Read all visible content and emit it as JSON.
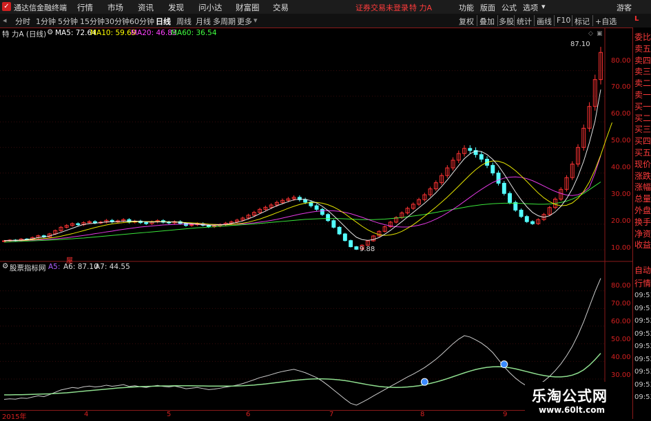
{
  "app": {
    "title": "通达信金融终端",
    "login_status": "证券交易未登录",
    "stock_name": "特 力A"
  },
  "menu": [
    "行情",
    "市场",
    "资讯",
    "发现",
    "问小达",
    "财富圈",
    "交易"
  ],
  "right_menu": [
    "功能",
    "版面",
    "公式",
    "选项",
    "游客"
  ],
  "tabs": [
    "分时",
    "1分钟",
    "5分钟",
    "15分钟",
    "30分钟",
    "60分钟",
    "日线",
    "周线",
    "月线",
    "多周期",
    "更多"
  ],
  "active_tab": "日线",
  "right_tabs": [
    "复权",
    "叠加",
    "多股",
    "统计",
    "画线",
    "F10",
    "标记",
    "+自选"
  ],
  "info": {
    "title": "特 力A (日线)",
    "ma5": "MA5: 72.64",
    "ma10": "MA10: 59.69",
    "ma20": "MA20: 46.83",
    "ma60": "MA60: 36.54",
    "colors": {
      "ma5": "#ffffff",
      "ma10": "#ffff00",
      "ma20": "#ff40ff",
      "ma60": "#40ff40"
    }
  },
  "main_axis": [
    "80.00",
    "70.00",
    "60.00",
    "50.00",
    "40.00",
    "30.00",
    "20.00",
    "10.00"
  ],
  "annotations": {
    "high": "87.10",
    "low": "9.88"
  },
  "lower": {
    "title": "股票指标网",
    "a5": "A5:",
    "a6": "A6: 87.10",
    "a7": "A7: 44.55",
    "mark": "屋"
  },
  "lower_axis": [
    "80.00",
    "70.00",
    "60.00",
    "50.00",
    "40.00",
    "30.00"
  ],
  "dates": [
    "2015年",
    "4",
    "5",
    "6",
    "7",
    "8",
    "9"
  ],
  "right_panel_top": [
    "委比",
    "卖五",
    "卖四",
    "卖三",
    "卖二",
    "卖一",
    "买一",
    "买二",
    "买三",
    "买四",
    "买五",
    "现价",
    "涨跌",
    "涨幅",
    "总量",
    "外盘",
    "换手",
    "净资",
    "收益"
  ],
  "right_panel_bottom": [
    "自动",
    "行情",
    "09:51",
    "09:51",
    "09:52",
    "09:52",
    "09:52",
    "09:52",
    "09:53",
    "09:53",
    "09:53"
  ],
  "top_right_label": "L",
  "watermark": {
    "line1": "乐淘公式网",
    "line2": "www.60lt.com"
  },
  "chart_data": {
    "type": "candlestick",
    "price_range": [
      5,
      92
    ],
    "closes": [
      13.5,
      13.8,
      13.6,
      14.2,
      14.0,
      14.8,
      15.5,
      15.0,
      16.2,
      17.5,
      18.8,
      19.5,
      20.2,
      19.8,
      20.6,
      21.0,
      20.5,
      20.8,
      21.5,
      20.9,
      21.3,
      21.8,
      20.8,
      21.2,
      20.6,
      20.2,
      20.9,
      21.4,
      20.8,
      20.5,
      21.0,
      20.3,
      19.5,
      19.8,
      20.2,
      19.6,
      19.0,
      19.3,
      19.8,
      20.4,
      20.9,
      21.6,
      22.4,
      23.5,
      24.6,
      25.8,
      26.6,
      27.5,
      28.5,
      29.3,
      29.9,
      30.5,
      29.6,
      28.6,
      27.2,
      25.8,
      23.8,
      21.4,
      18.8,
      16.2,
      13.6,
      11.2,
      10.2,
      11.8,
      13.5,
      15.4,
      17.2,
      19.0,
      20.8,
      22.6,
      24.4,
      26.2,
      27.8,
      29.6,
      31.5,
      33.8,
      36.2,
      39.0,
      42.0,
      45.0,
      47.6,
      49.6,
      48.8,
      47.2,
      45.4,
      43.0,
      40.0,
      36.0,
      32.0,
      28.5,
      25.5,
      23.0,
      21.0,
      20.2,
      21.8,
      23.8,
      26.5,
      29.8,
      33.6,
      38.2,
      43.5,
      50.0,
      57.5,
      66.0,
      76.5,
      87.1
    ],
    "ma5": [
      13.6,
      13.7,
      13.7,
      13.8,
      14.0,
      14.3,
      14.8,
      15.0,
      15.4,
      16.1,
      16.8,
      17.6,
      18.4,
      19.2,
      19.9,
      20.2,
      20.4,
      20.6,
      20.9,
      20.9,
      21.0,
      21.2,
      21.2,
      21.2,
      21.1,
      20.9,
      20.8,
      20.9,
      20.9,
      20.8,
      20.9,
      20.7,
      20.4,
      20.2,
      20.0,
      19.7,
      19.6,
      19.6,
      19.7,
      19.9,
      20.3,
      20.7,
      21.3,
      22.1,
      23.0,
      24.1,
      25.1,
      26.2,
      27.2,
      28.0,
      28.8,
      29.5,
      29.8,
      29.7,
      29.2,
      28.3,
      27.0,
      25.3,
      23.3,
      21.2,
      19.0,
      16.8,
      14.9,
      14.0,
      13.7,
      14.0,
      14.8,
      16.1,
      17.6,
      19.3,
      21.0,
      22.8,
      24.6,
      26.4,
      28.2,
      30.2,
      32.3,
      34.7,
      37.3,
      40.1,
      42.9,
      45.6,
      47.5,
      48.6,
      48.4,
      47.2,
      45.3,
      42.8,
      39.6,
      36.1,
      32.6,
      29.5,
      26.8,
      24.6,
      23.3,
      22.7,
      23.3,
      24.8,
      27.0,
      30.0,
      33.8,
      38.7,
      44.6,
      51.8,
      60.3,
      72.6
    ],
    "ma10": [
      13.6,
      13.6,
      13.7,
      13.7,
      13.8,
      14.0,
      14.2,
      14.4,
      14.6,
      14.9,
      15.3,
      15.8,
      16.3,
      16.9,
      17.5,
      18.1,
      18.7,
      19.2,
      19.7,
      20.1,
      20.4,
      20.6,
      20.8,
      20.9,
      21.0,
      21.0,
      21.0,
      21.0,
      21.0,
      20.9,
      20.9,
      20.8,
      20.6,
      20.5,
      20.4,
      20.2,
      20.0,
      19.9,
      19.8,
      19.8,
      19.9,
      20.1,
      20.4,
      20.8,
      21.4,
      22.0,
      22.8,
      23.6,
      24.5,
      25.3,
      26.2,
      27.0,
      27.7,
      28.2,
      28.5,
      28.5,
      28.2,
      27.6,
      26.7,
      25.5,
      24.0,
      22.4,
      20.8,
      19.2,
      17.8,
      16.7,
      15.9,
      15.6,
      15.8,
      16.3,
      17.2,
      18.4,
      19.8,
      21.4,
      23.1,
      24.9,
      26.7,
      28.6,
      30.6,
      32.7,
      34.9,
      37.1,
      39.3,
      41.3,
      43.0,
      44.2,
      44.7,
      44.6,
      43.9,
      42.6,
      40.9,
      38.9,
      36.7,
      34.4,
      32.2,
      30.3,
      28.8,
      27.7,
      27.2,
      27.4,
      28.3,
      30.1,
      32.8,
      36.5,
      41.3,
      47.0,
      53.5,
      59.7
    ],
    "ma20": [
      13.5,
      13.5,
      13.6,
      13.6,
      13.7,
      13.8,
      13.9,
      14.0,
      14.1,
      14.3,
      14.5,
      14.7,
      15.0,
      15.3,
      15.6,
      15.9,
      16.3,
      16.6,
      17.0,
      17.3,
      17.7,
      18.0,
      18.3,
      18.6,
      18.9,
      19.1,
      19.3,
      19.5,
      19.7,
      19.8,
      19.9,
      20.0,
      20.0,
      20.0,
      20.0,
      20.0,
      19.9,
      19.9,
      19.9,
      19.9,
      19.9,
      20.0,
      20.1,
      20.3,
      20.5,
      20.8,
      21.1,
      21.5,
      21.9,
      22.4,
      22.9,
      23.4,
      23.9,
      24.3,
      24.7,
      25.0,
      25.2,
      25.3,
      25.2,
      25.0,
      24.6,
      24.1,
      23.4,
      22.7,
      21.9,
      21.1,
      20.4,
      19.8,
      19.3,
      19.0,
      18.9,
      18.9,
      19.2,
      19.6,
      20.2,
      21.0,
      22.0,
      23.1,
      24.4,
      25.8,
      27.3,
      28.9,
      30.5,
      32.1,
      33.6,
      35.0,
      36.3,
      37.3,
      38.0,
      38.4,
      38.5,
      38.3,
      37.8,
      37.0,
      36.0,
      34.9,
      33.8,
      32.8,
      32.0,
      31.4,
      31.2,
      31.5,
      32.5,
      34.4,
      40.0,
      46.8
    ],
    "ma60": [
      13.0,
      13.1,
      13.2,
      13.3,
      13.4,
      13.5,
      13.6,
      13.7,
      13.8,
      13.9,
      14.0,
      14.2,
      14.3,
      14.5,
      14.6,
      14.8,
      15.0,
      15.2,
      15.4,
      15.6,
      15.8,
      16.0,
      16.2,
      16.4,
      16.6,
      16.8,
      17.0,
      17.2,
      17.4,
      17.6,
      17.8,
      18.0,
      18.2,
      18.4,
      18.6,
      18.7,
      18.9,
      19.0,
      19.2,
      19.3,
      19.5,
      19.6,
      19.8,
      19.9,
      20.1,
      20.3,
      20.5,
      20.7,
      20.9,
      21.1,
      21.3,
      21.5,
      21.7,
      21.9,
      22.0,
      22.1,
      22.2,
      22.2,
      22.2,
      22.2,
      22.1,
      22.0,
      21.9,
      21.8,
      21.8,
      21.8,
      21.9,
      22.0,
      22.2,
      22.4,
      22.6,
      22.9,
      23.2,
      23.5,
      23.8,
      24.2,
      24.6,
      25.0,
      25.4,
      25.8,
      26.2,
      26.6,
      27.0,
      27.3,
      27.6,
      27.8,
      28.0,
      28.1,
      28.2,
      28.2,
      28.2,
      28.1,
      28.0,
      27.9,
      27.8,
      27.8,
      27.9,
      28.1,
      28.5,
      29.0,
      29.8,
      30.8,
      32.0,
      33.5,
      35.0,
      36.5
    ],
    "indicator_a6": [
      18.5,
      18.8,
      18.6,
      19.2,
      19.0,
      19.8,
      20.5,
      20.0,
      21.2,
      22.5,
      23.8,
      24.5,
      25.2,
      24.8,
      25.6,
      26.0,
      25.5,
      25.8,
      26.5,
      25.9,
      26.3,
      26.8,
      25.8,
      26.2,
      25.6,
      25.2,
      25.9,
      26.4,
      25.8,
      25.5,
      26.0,
      25.3,
      24.5,
      24.8,
      25.2,
      24.6,
      24.0,
      24.3,
      24.8,
      25.4,
      25.9,
      26.6,
      27.4,
      28.5,
      29.6,
      30.8,
      31.6,
      32.5,
      33.5,
      34.3,
      34.9,
      35.5,
      34.6,
      33.6,
      32.2,
      30.8,
      28.8,
      26.4,
      23.8,
      21.2,
      18.6,
      16.2,
      15.2,
      16.8,
      18.5,
      20.4,
      22.2,
      24.0,
      25.8,
      27.6,
      29.4,
      31.2,
      32.8,
      34.6,
      36.5,
      38.8,
      41.2,
      44.0,
      47.0,
      50.0,
      52.6,
      54.6,
      53.8,
      52.2,
      50.4,
      48.0,
      45.0,
      41.0,
      37.0,
      33.5,
      30.5,
      28.0,
      26.0,
      25.2,
      26.8,
      28.8,
      31.5,
      34.8,
      38.6,
      43.2,
      48.5,
      55.0,
      62.5,
      71.0,
      79.5,
      87.1
    ],
    "indicator_a7": [
      21.0,
      21.0,
      21.1,
      21.1,
      21.2,
      21.3,
      21.4,
      21.5,
      21.6,
      21.8,
      22.0,
      22.2,
      22.5,
      22.8,
      23.1,
      23.4,
      23.7,
      24.0,
      24.3,
      24.6,
      24.9,
      25.1,
      25.3,
      25.5,
      25.7,
      25.8,
      25.9,
      26.0,
      26.1,
      26.1,
      26.2,
      26.2,
      26.2,
      26.2,
      26.1,
      26.1,
      26.0,
      26.0,
      26.0,
      26.0,
      26.0,
      26.1,
      26.2,
      26.4,
      26.6,
      26.9,
      27.2,
      27.6,
      28.0,
      28.4,
      28.8,
      29.2,
      29.5,
      29.8,
      30.0,
      30.1,
      30.1,
      30.0,
      29.8,
      29.5,
      29.1,
      28.6,
      28.0,
      27.4,
      26.8,
      26.3,
      25.8,
      25.5,
      25.3,
      25.2,
      25.3,
      25.5,
      25.8,
      26.2,
      26.8,
      27.5,
      28.3,
      29.2,
      30.2,
      31.3,
      32.4,
      33.5,
      34.5,
      35.4,
      36.1,
      36.6,
      36.9,
      37.0,
      36.8,
      36.4,
      35.8,
      35.0,
      34.2,
      33.4,
      32.6,
      32.0,
      31.5,
      31.2,
      31.2,
      31.5,
      32.2,
      33.4,
      35.2,
      37.8,
      41.0,
      44.55
    ]
  }
}
